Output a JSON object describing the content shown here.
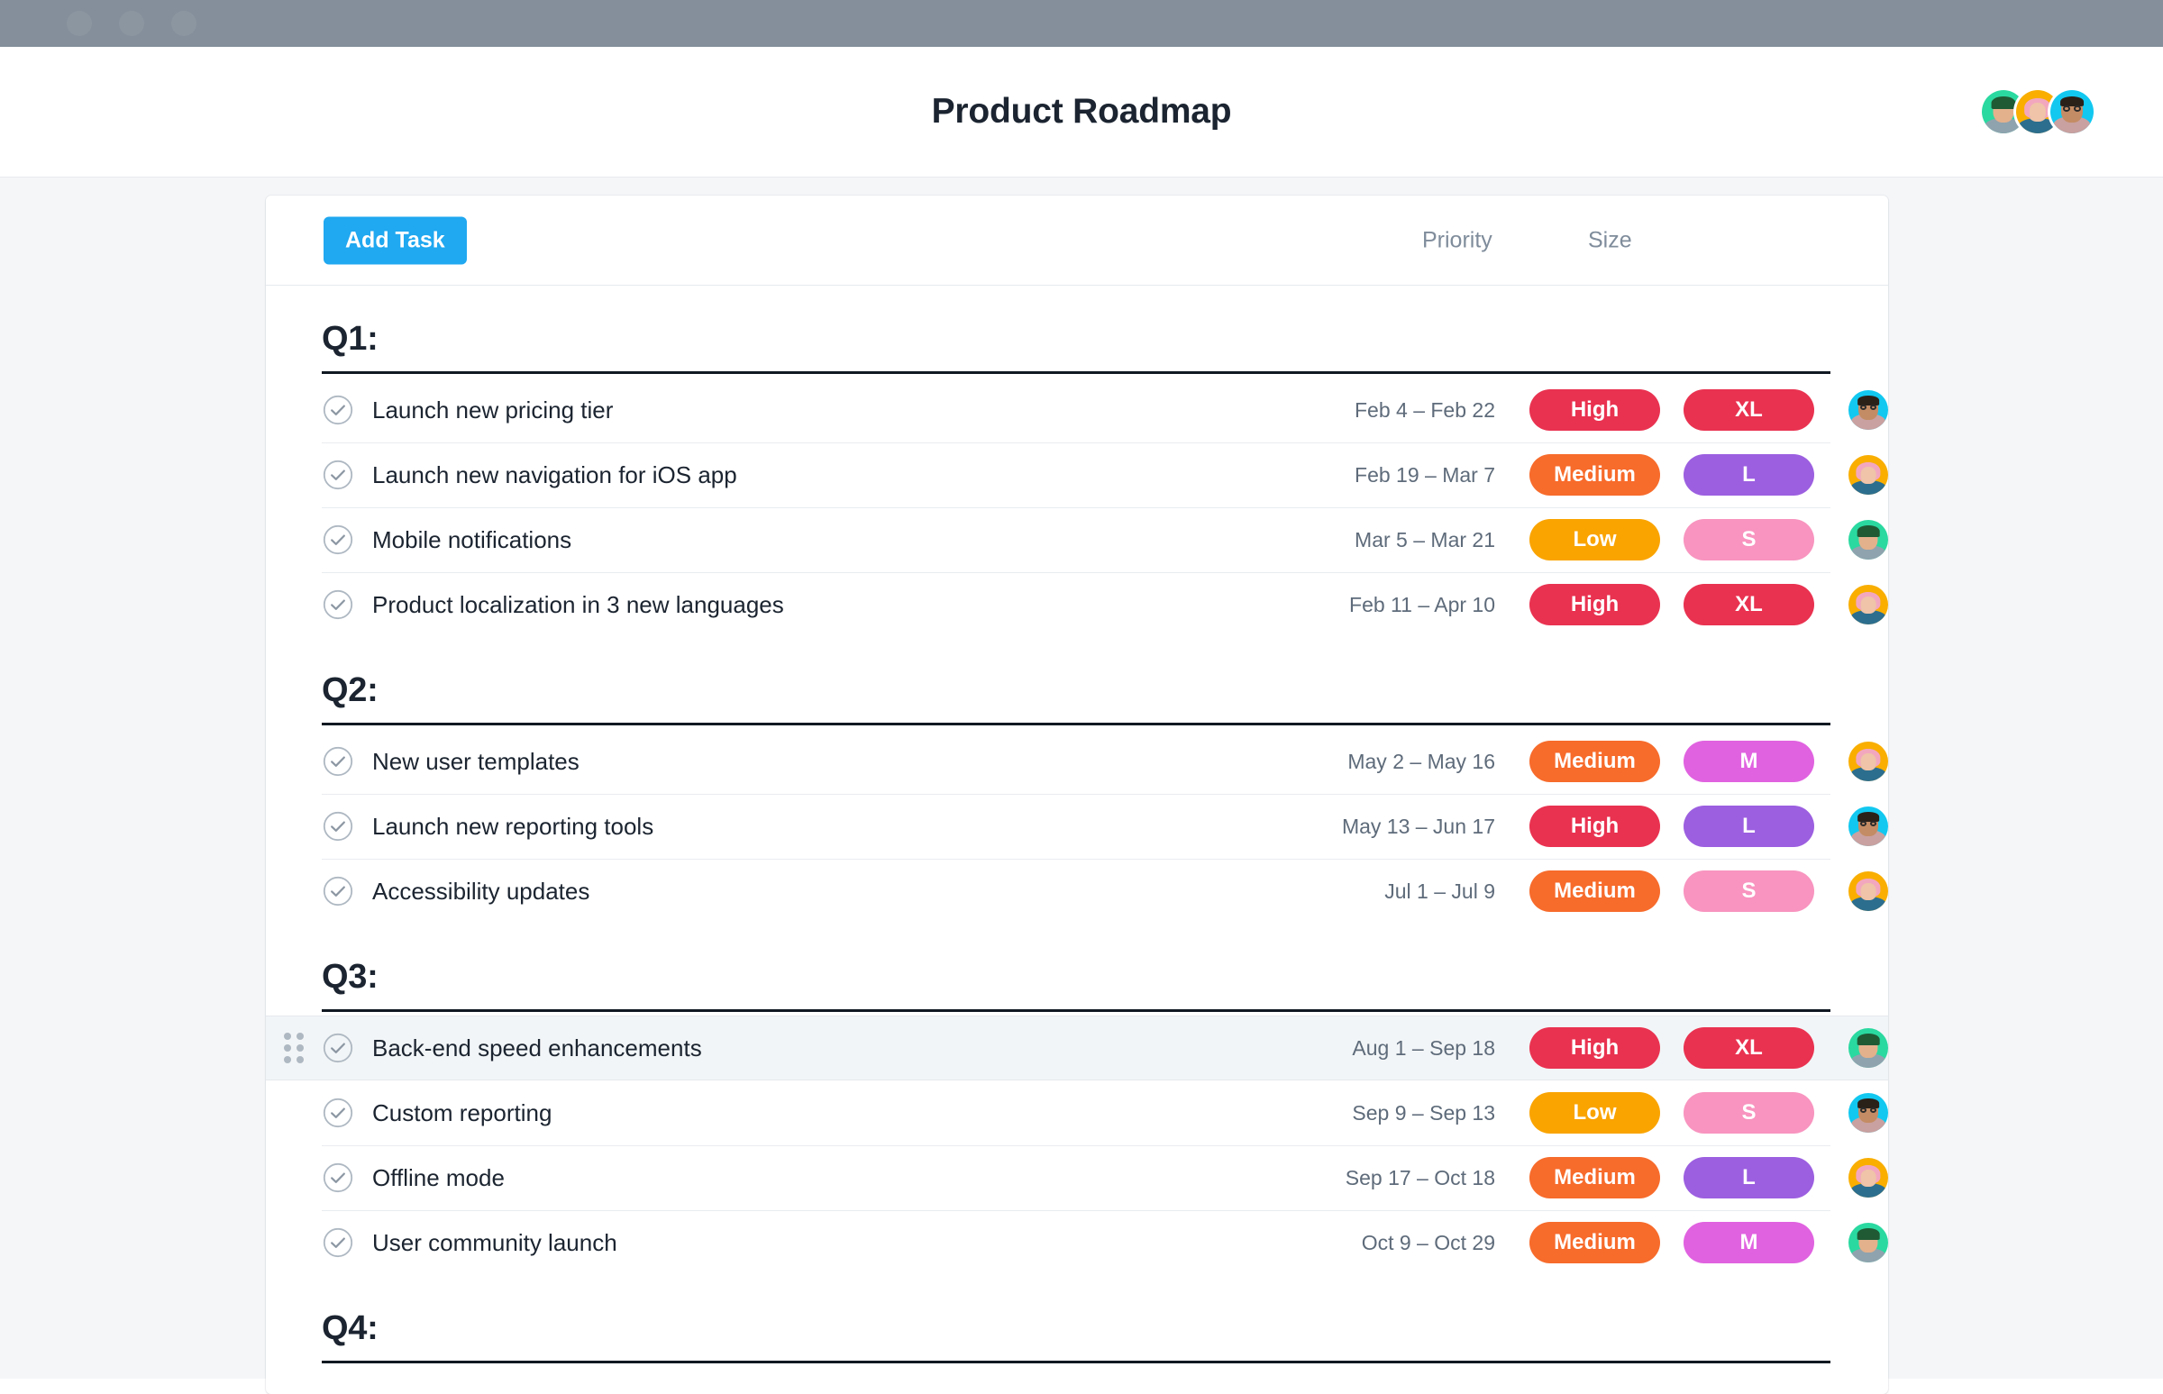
{
  "window": {
    "traffic_lights": [
      "close",
      "minimize",
      "zoom"
    ]
  },
  "header": {
    "title": "Product Roadmap",
    "members": [
      {
        "name": "member-avatar-1",
        "bg": "#2AD9A0",
        "type": "short-hair-cap"
      },
      {
        "name": "member-avatar-2",
        "bg": "#F9AE00",
        "type": "pink-bob"
      },
      {
        "name": "member-avatar-3",
        "bg": "#12C8F0",
        "type": "glasses"
      }
    ]
  },
  "toolbar": {
    "add_task_label": "Add Task",
    "priority_header": "Priority",
    "size_header": "Size"
  },
  "colors": {
    "accent_blue": "#20A8F0",
    "priority_high": "#E93250",
    "priority_medium": "#F76B2B",
    "priority_low": "#FAA400",
    "size_xl": "#E93250",
    "size_l": "#9C5FE0",
    "size_m": "#E062E0",
    "size_s": "#F894BF",
    "page_bg": "#F4F6F8",
    "titlebar": "#848F9B",
    "row_highlight": "#F2F5F7"
  },
  "sections": [
    {
      "title": "Q1:",
      "tasks": [
        {
          "name": "Launch new pricing tier",
          "dates": "Feb 4 – Feb 22",
          "priority": "High",
          "priority_color": "#E93250",
          "size": "XL",
          "size_color": "#E93250",
          "assignee_bg": "#12C8F0",
          "assignee_type": "glasses",
          "done": true,
          "active": false
        },
        {
          "name": "Launch new navigation for iOS app",
          "dates": "Feb 19 – Mar 7",
          "priority": "Medium",
          "priority_color": "#F76B2B",
          "size": "L",
          "size_color": "#9C5FE0",
          "assignee_bg": "#F9AE00",
          "assignee_type": "pink-bob",
          "done": true,
          "active": false
        },
        {
          "name": "Mobile notifications",
          "dates": "Mar 5 – Mar 21",
          "priority": "Low",
          "priority_color": "#FAA400",
          "size": "S",
          "size_color": "#F894BF",
          "assignee_bg": "#2AD9A0",
          "assignee_type": "short-hair-cap",
          "done": true,
          "active": false
        },
        {
          "name": "Product localization in 3 new languages",
          "dates": "Feb 11 – Apr 10",
          "priority": "High",
          "priority_color": "#E93250",
          "size": "XL",
          "size_color": "#E93250",
          "assignee_bg": "#F9AE00",
          "assignee_type": "pink-bob",
          "done": true,
          "active": false
        }
      ]
    },
    {
      "title": "Q2:",
      "tasks": [
        {
          "name": "New user templates",
          "dates": "May 2 – May 16",
          "priority": "Medium",
          "priority_color": "#F76B2B",
          "size": "M",
          "size_color": "#E062E0",
          "assignee_bg": "#F9AE00",
          "assignee_type": "pink-bob",
          "done": true,
          "active": false
        },
        {
          "name": "Launch new reporting tools",
          "dates": "May 13 – Jun 17",
          "priority": "High",
          "priority_color": "#E93250",
          "size": "L",
          "size_color": "#9C5FE0",
          "assignee_bg": "#12C8F0",
          "assignee_type": "glasses",
          "done": true,
          "active": false
        },
        {
          "name": "Accessibility updates",
          "dates": "Jul 1 – Jul 9",
          "priority": "Medium",
          "priority_color": "#F76B2B",
          "size": "S",
          "size_color": "#F894BF",
          "assignee_bg": "#F9AE00",
          "assignee_type": "pink-bob",
          "done": true,
          "active": false
        }
      ]
    },
    {
      "title": "Q3:",
      "tasks": [
        {
          "name": "Back-end speed enhancements",
          "dates": "Aug 1 – Sep 18",
          "priority": "High",
          "priority_color": "#E93250",
          "size": "XL",
          "size_color": "#E93250",
          "assignee_bg": "#2AD9A0",
          "assignee_type": "short-hair-cap",
          "done": true,
          "active": true
        },
        {
          "name": "Custom reporting",
          "dates": "Sep 9 – Sep 13",
          "priority": "Low",
          "priority_color": "#FAA400",
          "size": "S",
          "size_color": "#F894BF",
          "assignee_bg": "#12C8F0",
          "assignee_type": "glasses",
          "done": true,
          "active": false
        },
        {
          "name": "Offline mode",
          "dates": "Sep 17 – Oct 18",
          "priority": "Medium",
          "priority_color": "#F76B2B",
          "size": "L",
          "size_color": "#9C5FE0",
          "assignee_bg": "#F9AE00",
          "assignee_type": "pink-bob",
          "done": true,
          "active": false
        },
        {
          "name": "User community launch",
          "dates": "Oct 9 – Oct 29",
          "priority": "Medium",
          "priority_color": "#F76B2B",
          "size": "M",
          "size_color": "#E062E0",
          "assignee_bg": "#2AD9A0",
          "assignee_type": "short-hair-cap",
          "done": true,
          "active": false
        }
      ]
    },
    {
      "title": "Q4:",
      "tasks": []
    }
  ]
}
